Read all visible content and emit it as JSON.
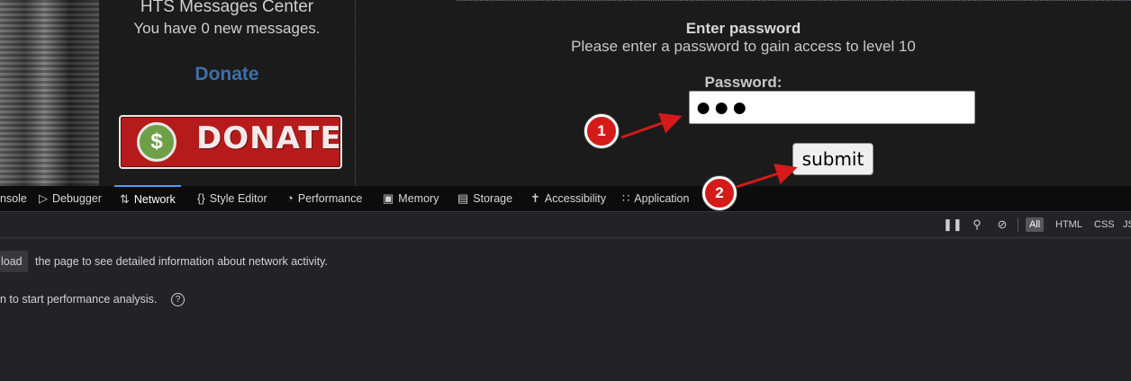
{
  "site": {
    "messages_title": "HTS Messages Center",
    "messages_count": "You have 0 new messages.",
    "donate_link": "Donate",
    "donate_button": {
      "symbol": "$",
      "text": "DONATE"
    },
    "enter_password_title": "Enter password",
    "enter_password_desc": "Please enter a password to gain access to level 10",
    "password_label": "Password:",
    "password_value": "●●●",
    "submit_label": "submit"
  },
  "annotations": {
    "marker_1": "1",
    "marker_2": "2",
    "color": "#d51a1a"
  },
  "devtools": {
    "tabs": [
      {
        "label": "nsole",
        "icon": "console-icon"
      },
      {
        "label": "Debugger",
        "icon": "debugger-icon"
      },
      {
        "label": "Network",
        "icon": "network-icon",
        "active": true
      },
      {
        "label": "Style Editor",
        "icon": "style-editor-icon"
      },
      {
        "label": "Performance",
        "icon": "performance-icon"
      },
      {
        "label": "Memory",
        "icon": "memory-icon"
      },
      {
        "label": "Storage",
        "icon": "storage-icon"
      },
      {
        "label": "Accessibility",
        "icon": "accessibility-icon"
      },
      {
        "label": "Application",
        "icon": "application-icon"
      }
    ],
    "filters": [
      "All",
      "HTML",
      "CSS",
      "JS"
    ],
    "reload_button": "load",
    "reload_message": "the page to see detailed information about network activity.",
    "perf_message": "n to start performance analysis.",
    "accent": "#4a9eff"
  }
}
